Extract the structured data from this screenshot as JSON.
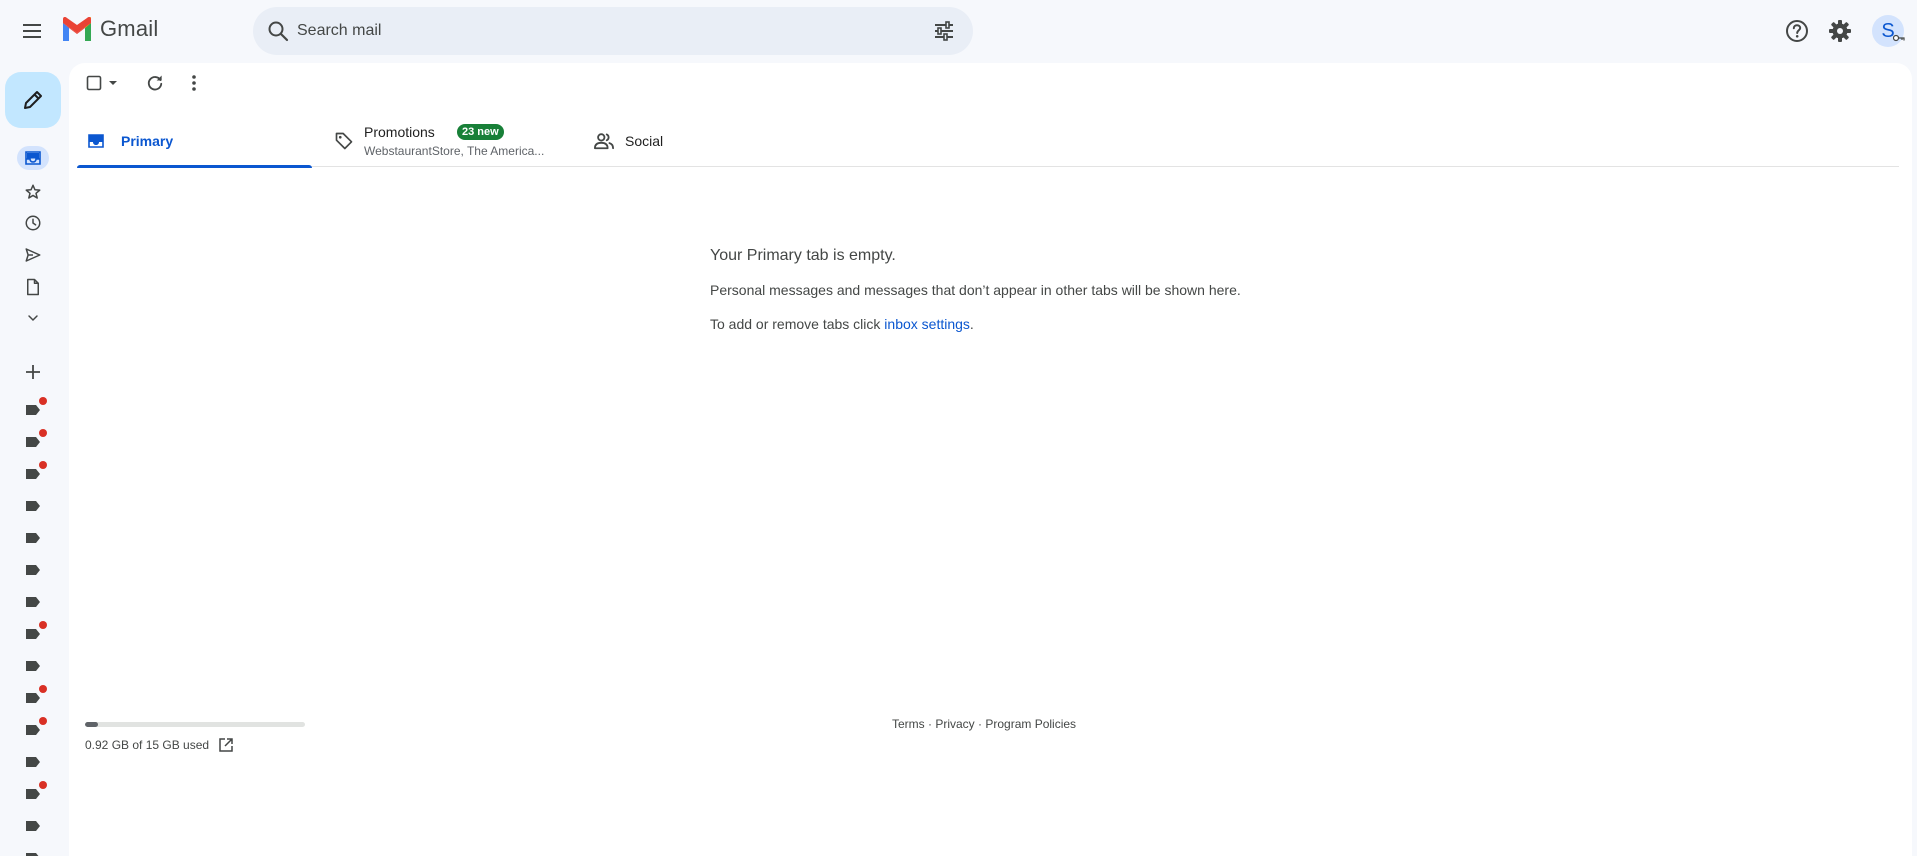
{
  "app": {
    "name": "Gmail"
  },
  "search": {
    "placeholder": "Search mail"
  },
  "account": {
    "initial": "S"
  },
  "tabs": {
    "primary": {
      "label": "Primary"
    },
    "promotions": {
      "label": "Promotions",
      "badge": "23 new",
      "snippet": "WebstaurantStore, The America..."
    },
    "social": {
      "label": "Social"
    }
  },
  "empty_state": {
    "title": "Your Primary tab is empty.",
    "description": "Personal messages and messages that don’t appear in other tabs will be shown here.",
    "hint_prefix": "To add or remove tabs click ",
    "hint_link": "inbox settings",
    "hint_suffix": "."
  },
  "storage": {
    "text": "0.92 GB of 15 GB used",
    "fraction_used": 0.061
  },
  "footer": {
    "terms": "Terms",
    "privacy": "Privacy",
    "policies": "Program Policies",
    "separator": " · "
  },
  "labels_unread": [
    true,
    true,
    true,
    false,
    false,
    false,
    false,
    true,
    false,
    true,
    true,
    false,
    true,
    false,
    false
  ],
  "colors": {
    "accent": "#0b57d0",
    "compose": "#c2e7ff",
    "promotions_badge": "#188038",
    "unread_dot": "#d93025"
  }
}
